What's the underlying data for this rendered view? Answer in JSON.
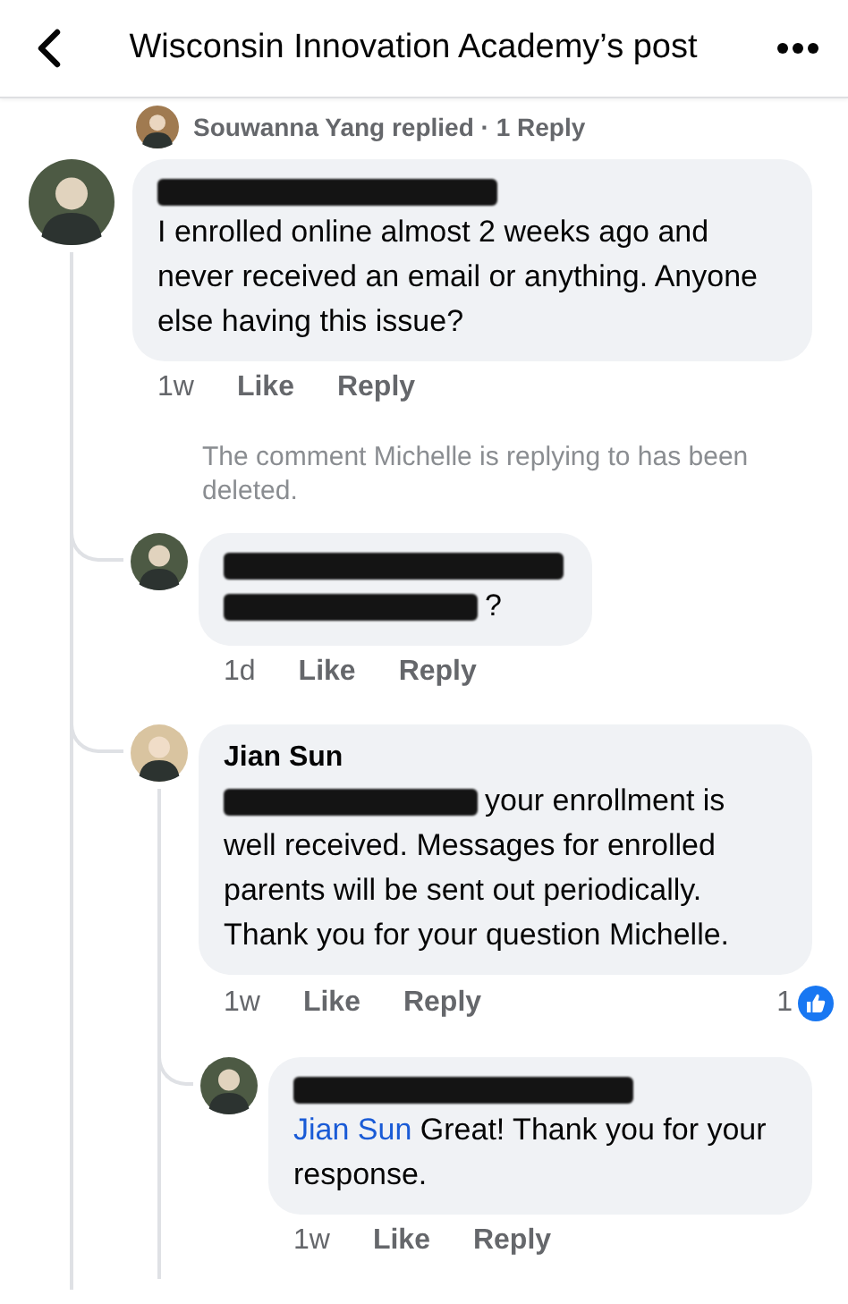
{
  "header": {
    "title": "Wisconsin Innovation Academy’s post"
  },
  "collapsed_reply": {
    "color": "#a07a50",
    "text": "Souwanna Yang replied · 1 Reply"
  },
  "comments": [
    {
      "color": "#4d5a44",
      "redacted": true,
      "text": "I enrolled online almost 2 weeks ago and never received an email or anything. Anyone else having this issue?",
      "time": "1w",
      "actions": [
        "Like",
        "Reply"
      ],
      "replies": [
        {
          "kind": "notice",
          "text": "The comment Michelle is replying to has been deleted."
        },
        {
          "kind": "comment",
          "color": "#4d5a44",
          "redacted": true,
          "mention_redacted": true,
          "text": "?",
          "time": "1d",
          "actions": [
            "Like",
            "Reply"
          ]
        },
        {
          "kind": "comment",
          "color": "#d9c4a0",
          "name": "Jian Sun",
          "mention_redacted": true,
          "text": "your enrollment is well received. Messages for enrolled parents will be sent out periodically. Thank you for your question Michelle.",
          "time": "1w",
          "actions": [
            "Like",
            "Reply"
          ],
          "reactions": "1",
          "replies": [
            {
              "kind": "comment",
              "color": "#4d5a44",
              "redacted": true,
              "mention": "Jian Sun",
              "text": "Great! Thank you for your response.",
              "time": "1w",
              "actions": [
                "Like",
                "Reply"
              ]
            }
          ]
        }
      ]
    }
  ]
}
